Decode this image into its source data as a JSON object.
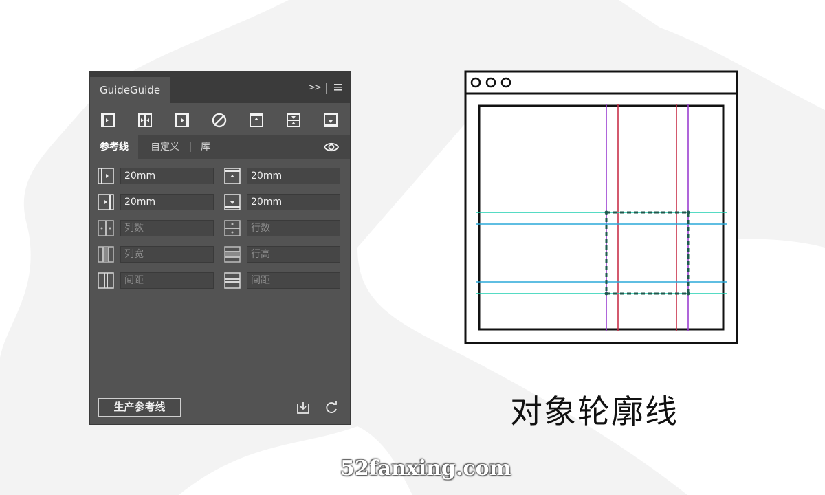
{
  "panel": {
    "title": "GuideGuide",
    "toolbar_icons": [
      "left-guide-icon",
      "center-vertical-guide-icon",
      "right-guide-icon",
      "clear-guides-icon",
      "top-guide-icon",
      "center-horizontal-guide-icon",
      "bottom-guide-icon"
    ],
    "tabs": [
      {
        "label": "参考线",
        "active": true
      },
      {
        "label": "自定义",
        "active": false
      },
      {
        "label": "库",
        "active": false
      }
    ],
    "fields": {
      "left_margin": {
        "value": "20mm"
      },
      "top_margin": {
        "value": "20mm"
      },
      "right_margin": {
        "value": "20mm"
      },
      "bottom_margin": {
        "value": "20mm"
      },
      "columns": {
        "placeholder": "列数"
      },
      "rows": {
        "placeholder": "行数"
      },
      "column_width": {
        "placeholder": "列宽"
      },
      "row_height": {
        "placeholder": "行高"
      },
      "column_gutter": {
        "placeholder": "间距"
      },
      "row_gutter": {
        "placeholder": "间距"
      }
    },
    "generate_button": "生产参考线"
  },
  "caption": "对象轮廓线",
  "watermark": "52fanxing.com",
  "colors": {
    "panel_bg": "#535353",
    "vertical_guides": "#9b3fd0",
    "horizontal_guides": "#1fcfb0"
  }
}
